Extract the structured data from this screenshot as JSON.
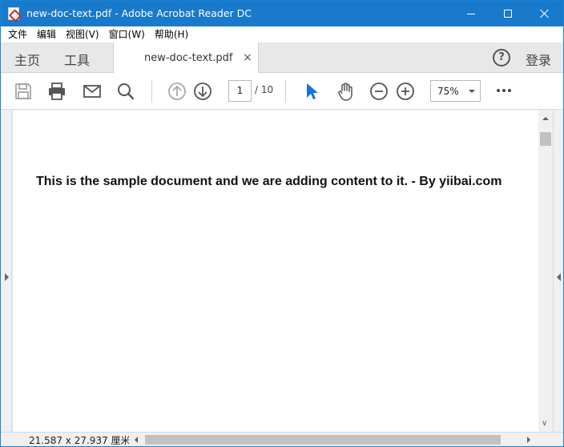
{
  "window": {
    "title": "new-doc-text.pdf - Adobe Acrobat Reader DC"
  },
  "menu": [
    {
      "label": "文件"
    },
    {
      "label": "编辑"
    },
    {
      "label": "视图(V)"
    },
    {
      "label": "窗口(W)"
    },
    {
      "label": "帮助(H)"
    }
  ],
  "tabs": {
    "home": "主页",
    "tools": "工具",
    "document": "new-doc-text.pdf",
    "close_glyph": "×",
    "help_glyph": "?",
    "signin": "登录"
  },
  "toolbar": {
    "icons": [
      "save-icon",
      "print-icon",
      "email-icon",
      "search-icon",
      "page-up-icon",
      "page-down-icon",
      "select-cursor-icon",
      "hand-tool-icon",
      "zoom-out-icon",
      "zoom-in-icon",
      "more-icon"
    ],
    "current_page": "1",
    "total_pages": "/ 10",
    "zoom": "75%"
  },
  "document": {
    "body_text": "This is the sample document and we are adding content to it. - By yiibai.com"
  },
  "statusbar": {
    "page_size": "21.587 x 27.937 厘米"
  },
  "colors": {
    "titlebar": "#1979ca",
    "accent_cursor": "#1473e6"
  }
}
